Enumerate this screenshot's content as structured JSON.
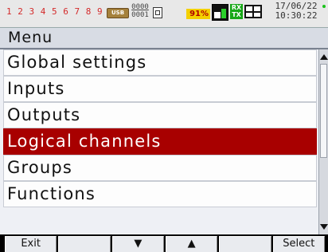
{
  "status_bar": {
    "channels": "1 2 3 4 5 6 7 8 9 10",
    "usb_label": "USB",
    "counter_top": "0000",
    "counter_bottom": "0001",
    "battery_percent": "91%",
    "rxtx_top": "RX",
    "rxtx_bottom": "TX",
    "date": "17/06/22",
    "time": "10:30:22",
    "icons": [
      "usb-icon",
      "small-square-icon",
      "disk-icon",
      "rx-tx-icon",
      "grid-icon",
      "status-dot-icon"
    ],
    "colors": {
      "channels": "#d42a2a",
      "battery_bg": "#f4d000",
      "battery_text": "#b00000",
      "rxtx": "#18a818"
    }
  },
  "title_bar": {
    "title": "Menu"
  },
  "menu": {
    "items": [
      {
        "label": "Global settings",
        "selected": false
      },
      {
        "label": "Inputs",
        "selected": false
      },
      {
        "label": "Outputs",
        "selected": false
      },
      {
        "label": "Logical channels",
        "selected": true
      },
      {
        "label": "Groups",
        "selected": false
      },
      {
        "label": "Functions",
        "selected": false
      }
    ],
    "selected_color": "#a80000"
  },
  "softkeys": {
    "exit": "Exit",
    "key2": "",
    "down": "▼",
    "up": "▲",
    "key5": "",
    "select": "Select"
  }
}
